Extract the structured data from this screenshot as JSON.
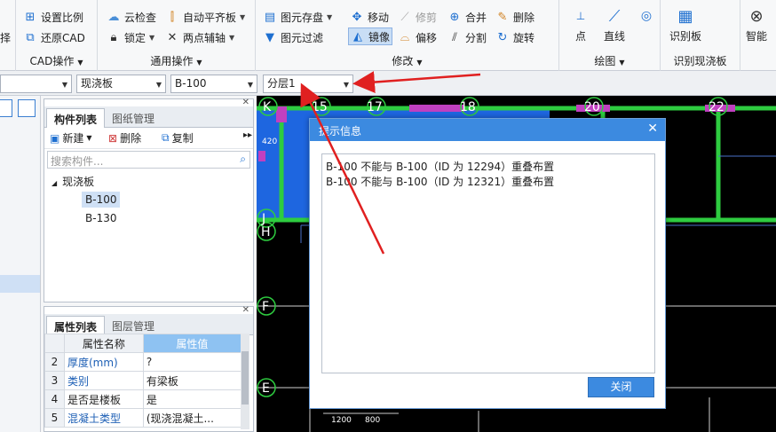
{
  "ribbon": {
    "cut_left_label": "择",
    "cad": {
      "set_scale": "设置比例",
      "restore_cad": "还原CAD",
      "title": "CAD操作"
    },
    "common": {
      "cloud_check": "云检查",
      "lock": "锁定",
      "auto_align": "自动平齐板",
      "two_point_axis": "两点辅轴",
      "title": "通用操作"
    },
    "modify": {
      "element_save": "图元存盘",
      "element_filter": "图元过滤",
      "move": "移动",
      "trim": "修剪",
      "merge": "合并",
      "delete": "删除",
      "mirror": "镜像",
      "offset": "偏移",
      "split": "分割",
      "rotate": "旋转",
      "title": "修改"
    },
    "draw": {
      "point": "点",
      "line": "直线",
      "title": "绘图"
    },
    "identify": {
      "identify_slab": "识别板",
      "title": "识别现浇板"
    },
    "cut_right_label": "智能"
  },
  "toolbar": {
    "combo0": "",
    "combo1": "现浇板",
    "combo2": "B-100",
    "combo3": "分层1"
  },
  "component_panel": {
    "tab_active": "构件列表",
    "tab_inactive": "图纸管理",
    "new_label": "新建",
    "delete_label": "删除",
    "copy_label": "复制",
    "search_placeholder": "搜索构件...",
    "tree_root": "现浇板",
    "items": [
      "B-100",
      "B-130"
    ]
  },
  "property_panel": {
    "tab_active": "属性列表",
    "tab_inactive": "图层管理",
    "col_name": "属性名称",
    "col_value": "属性值",
    "rows": [
      {
        "num": "2",
        "name": "厚度(mm)",
        "value": "?"
      },
      {
        "num": "3",
        "name": "类别",
        "value": "有梁板"
      },
      {
        "num": "4",
        "name": "是否是楼板",
        "value": "是"
      },
      {
        "num": "5",
        "name": "混凝土类型",
        "value": "(现浇混凝土..."
      }
    ]
  },
  "canvas": {
    "axis_numbers": [
      "15",
      "17",
      "18",
      "20",
      "22"
    ],
    "axis_letters": [
      "K",
      "J",
      "H",
      "F",
      "E"
    ],
    "dims": [
      "420",
      "1200",
      "800"
    ]
  },
  "dialog": {
    "title": "提示信息",
    "messages": [
      "B-100 不能与 B-100（ID 为 12294）重叠布置",
      "B-100 不能与 B-100（ID 为 12321）重叠布置"
    ],
    "close_button": "关闭"
  },
  "colors": {
    "accent": "#3c8ae0",
    "annotation_arrow": "#e02020",
    "canvas_bg": "#000000",
    "slab_green": "#2ecc40",
    "slab_blue": "#1e66e0"
  }
}
